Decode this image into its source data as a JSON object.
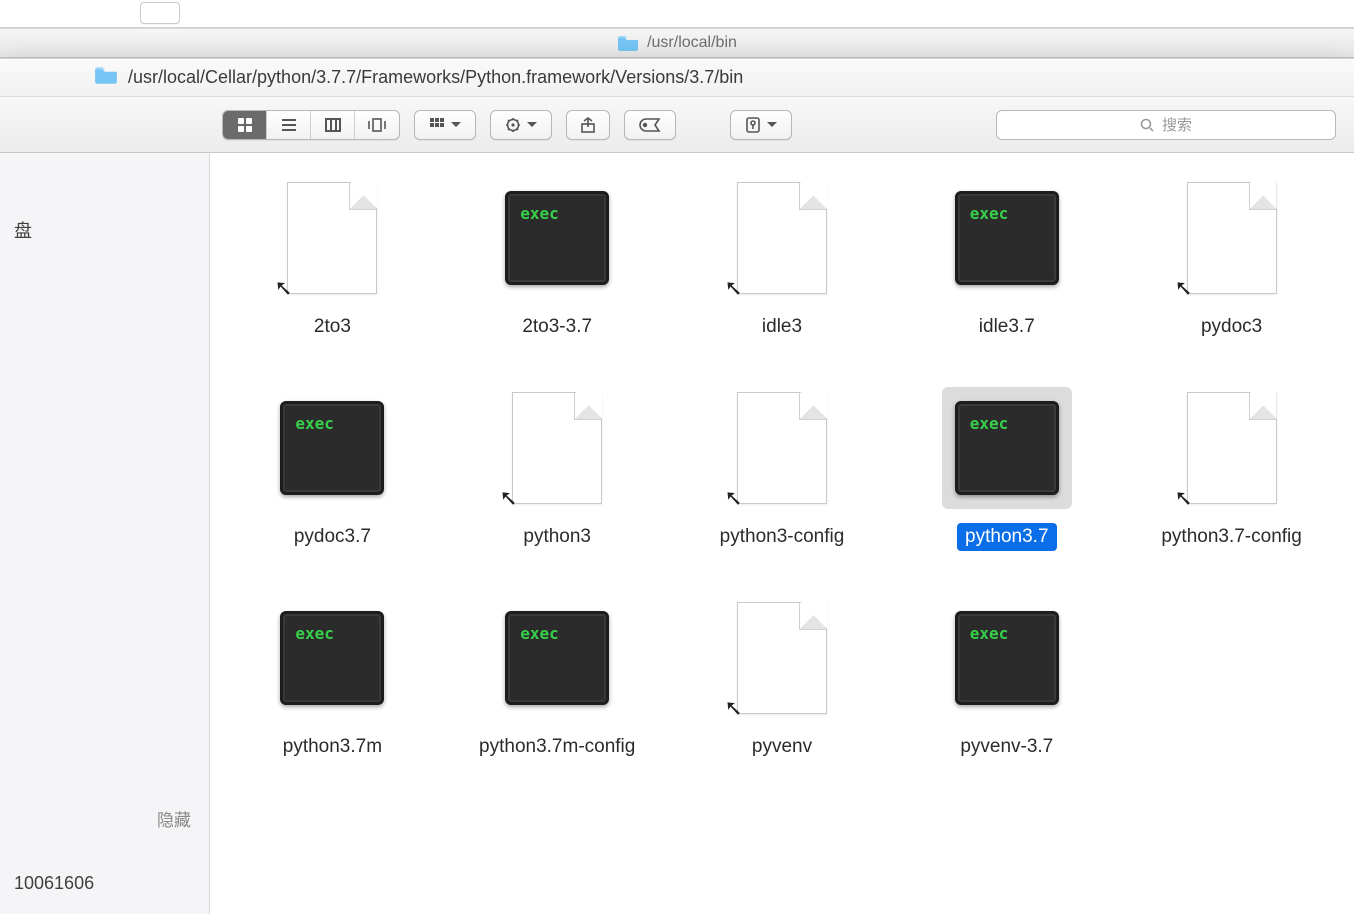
{
  "bg_window": {
    "path": "/usr/local/bin"
  },
  "window": {
    "path": "/usr/local/Cellar/python/3.7.7/Frameworks/Python.framework/Versions/3.7/bin"
  },
  "search": {
    "placeholder": "搜索"
  },
  "sidebar": {
    "items": [
      "",
      "",
      "盘",
      ""
    ],
    "hide_label": "隐藏",
    "extra": "10061606"
  },
  "exec_label": "exec",
  "files": [
    {
      "name": "2to3",
      "type": "alias"
    },
    {
      "name": "2to3-3.7",
      "type": "exec"
    },
    {
      "name": "idle3",
      "type": "alias"
    },
    {
      "name": "idle3.7",
      "type": "exec"
    },
    {
      "name": "pydoc3",
      "type": "alias"
    },
    {
      "name": "pydoc3.7",
      "type": "exec"
    },
    {
      "name": "python3",
      "type": "alias"
    },
    {
      "name": "python3-config",
      "type": "alias"
    },
    {
      "name": "python3.7",
      "type": "exec",
      "selected": true
    },
    {
      "name": "python3.7-config",
      "type": "alias"
    },
    {
      "name": "python3.7m",
      "type": "exec"
    },
    {
      "name": "python3.7m-config",
      "type": "exec"
    },
    {
      "name": "pyvenv",
      "type": "alias"
    },
    {
      "name": "pyvenv-3.7",
      "type": "exec"
    }
  ]
}
